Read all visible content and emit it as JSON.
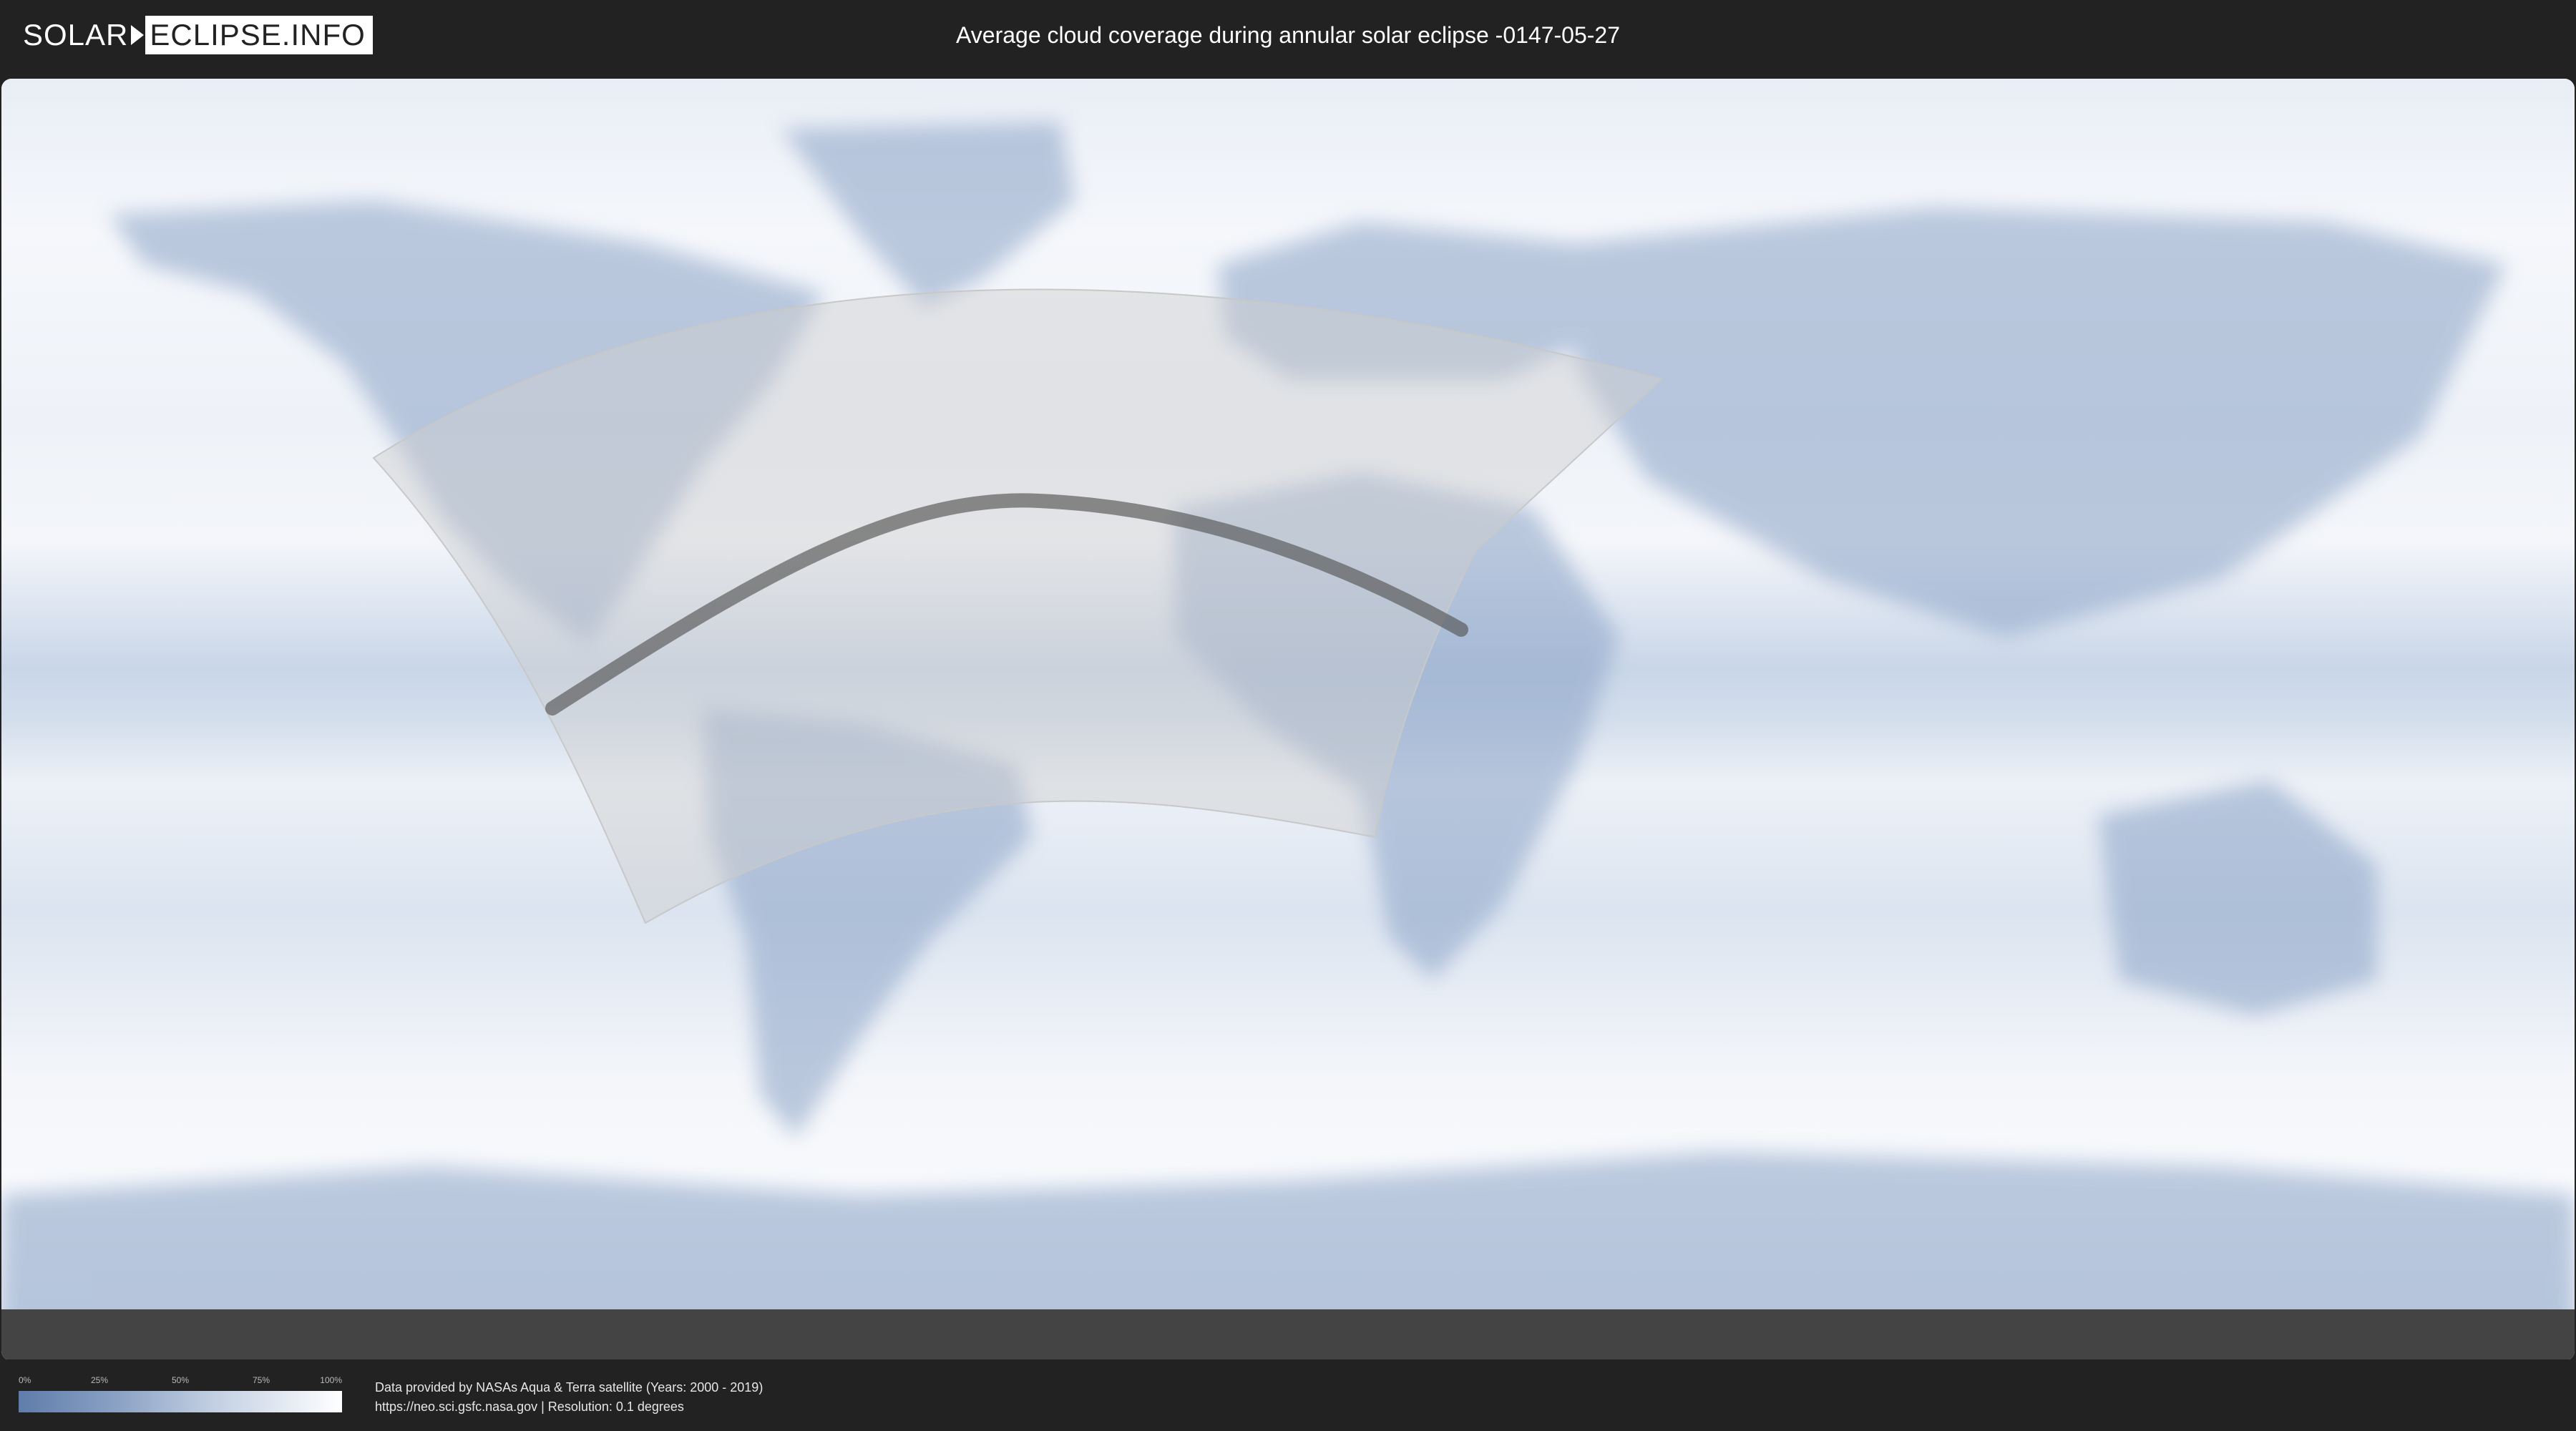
{
  "header": {
    "logo_left": "SOLAR",
    "logo_right": "ECLIPSE.INFO",
    "title": "Average cloud coverage during annular solar eclipse -0147-05-27"
  },
  "map": {
    "ocean_color": "#f2f5fa",
    "land_color": "#7f98bf",
    "penumbra_color": "#d0d0d0",
    "path_color": "#555555",
    "polar_band_color": "#444444"
  },
  "legend": {
    "ticks": [
      "0%",
      "25%",
      "50%",
      "75%",
      "100%"
    ],
    "gradient": [
      "#5f7dab",
      "#8aa1c4",
      "#c2cfe2",
      "#ffffff"
    ]
  },
  "footer": {
    "line1": "Data provided by NASAs Aqua & Terra satellite (Years: 2000 - 2019)",
    "line2": "https://neo.sci.gsfc.nasa.gov | Resolution: 0.1 degrees"
  }
}
